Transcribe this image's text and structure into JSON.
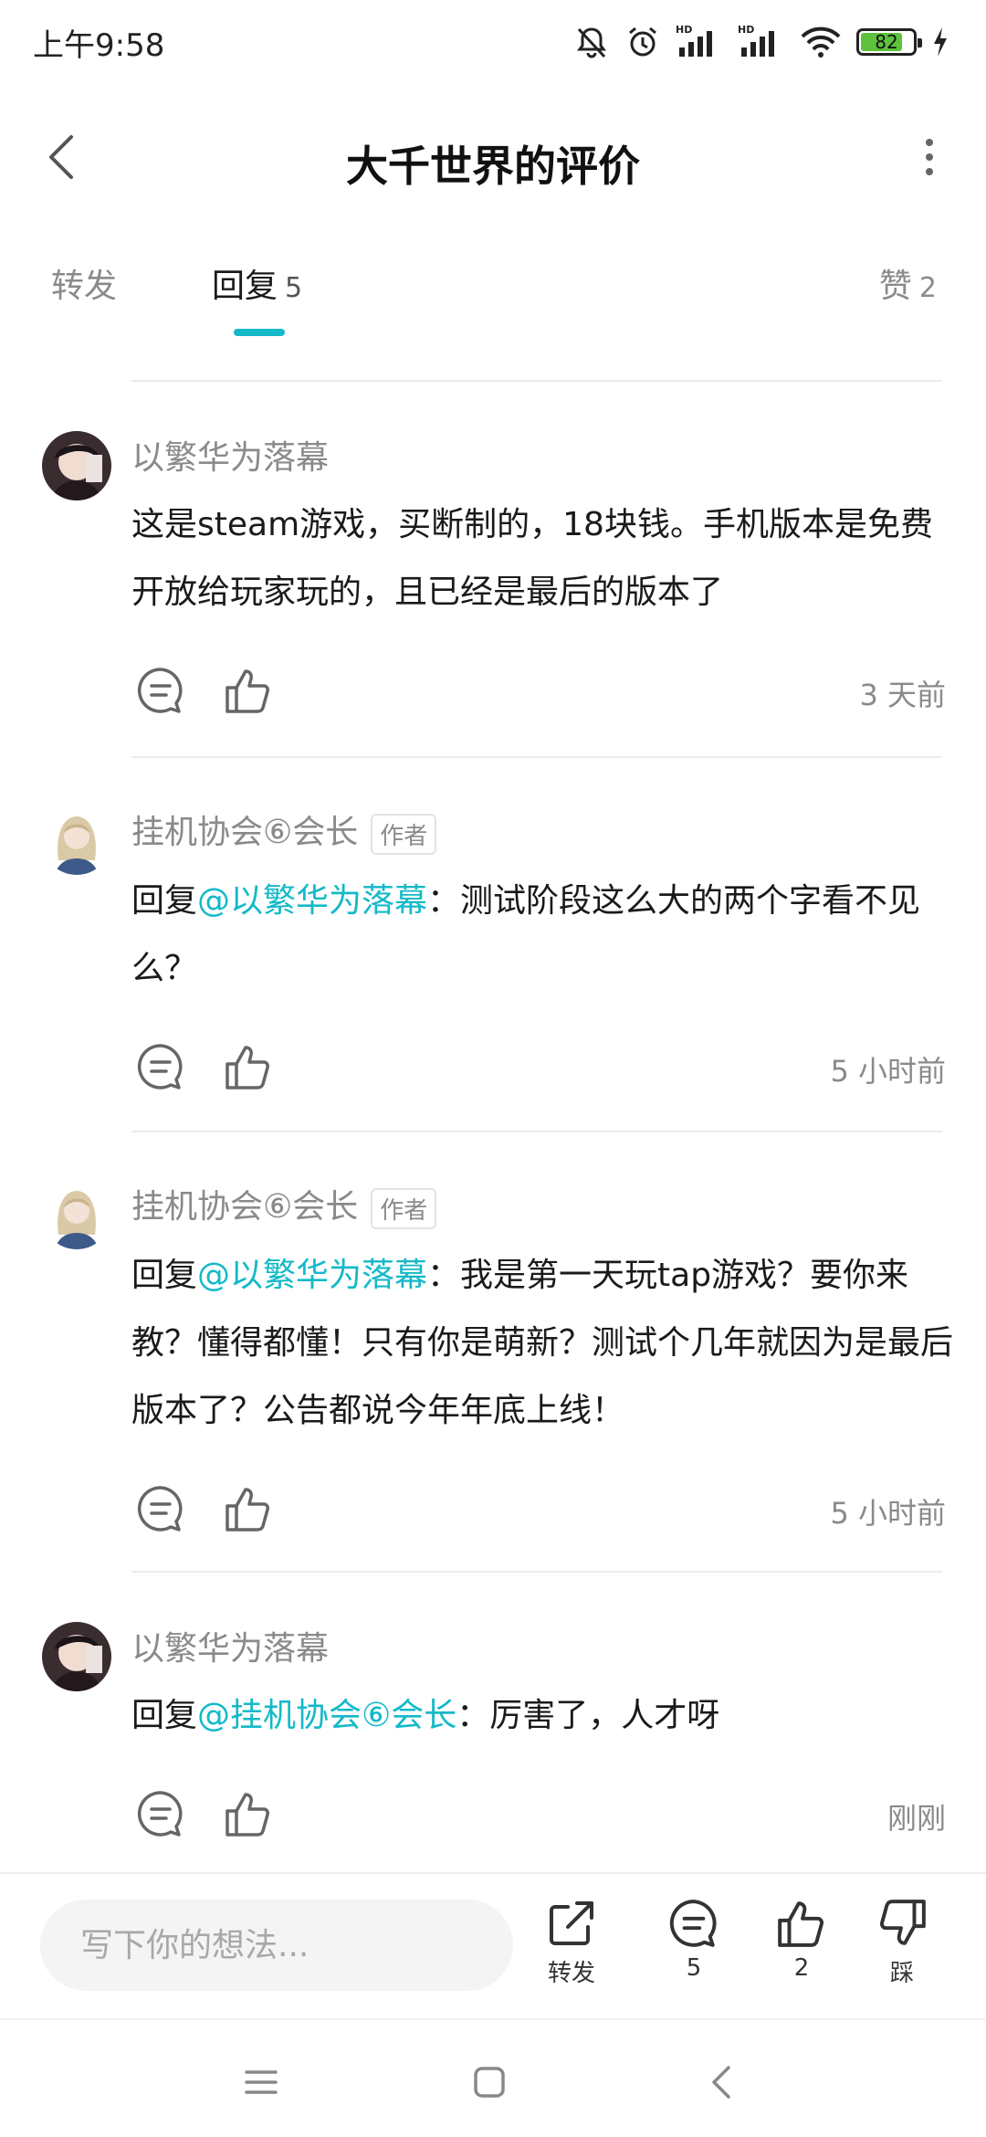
{
  "status_bar": {
    "time": "上午9:58",
    "network_label": "HD",
    "battery": "82",
    "battery_level": 0.82,
    "battery_color": "#5ec13c"
  },
  "header": {
    "title": "大千世界的评价"
  },
  "tabs": {
    "forward": {
      "label": "转发"
    },
    "reply": {
      "label": "回复",
      "count": "5"
    },
    "likes": {
      "label": "赞",
      "count": "2"
    },
    "active": "reply",
    "accent_color": "#14b9c8"
  },
  "comments": [
    {
      "username": "以繁华为落幕",
      "avatar": "dark-anime-avatar",
      "text": "这是steam游戏，买断制的，18块钱。手机版本是免费开放给玩家玩的，且已经是最后的版本了",
      "time": "3 天前"
    },
    {
      "username": "挂机协会⑥会长",
      "avatar": "blonde-anime-avatar",
      "author_tag": "作者",
      "reply_prefix": "回复",
      "mention": "@以繁华为落幕",
      "text": "：测试阶段这么大的两个字看不见么？",
      "time": "5 小时前"
    },
    {
      "username": "挂机协会⑥会长",
      "avatar": "blonde-anime-avatar",
      "author_tag": "作者",
      "reply_prefix": "回复",
      "mention": "@以繁华为落幕",
      "text": "：我是第一天玩tap游戏？要你来教？懂得都懂！只有你是萌新？测试个几年就因为是最后版本了？公告都说今年年底上线！",
      "time": "5 小时前"
    },
    {
      "username": "以繁华为落幕",
      "avatar": "dark-anime-avatar",
      "reply_prefix": "回复",
      "mention": "@挂机协会⑥会长",
      "text": "：厉害了，人才呀",
      "time": "刚刚"
    }
  ],
  "bottom_bar": {
    "input_placeholder": "写下你的想法...",
    "forward_label": "转发",
    "comment_count": "5",
    "like_count": "2",
    "dislike_label": "踩"
  }
}
